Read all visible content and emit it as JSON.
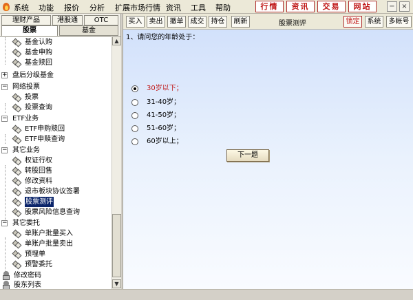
{
  "menubar": {
    "items": [
      "系统",
      "功能",
      "报价",
      "分析",
      "扩展市场行情",
      "资讯",
      "工具",
      "帮助"
    ],
    "right_buttons": [
      "行情",
      "资讯",
      "交易",
      "网站"
    ],
    "window_controls": {
      "minimize": "−",
      "close": "×"
    }
  },
  "sidebar": {
    "product_tabs": [
      "理财产品",
      "港股通",
      "OTC"
    ],
    "section_tabs": [
      "股票",
      "基金"
    ],
    "tree": [
      {
        "label": "基金认购"
      },
      {
        "label": "基金申购"
      },
      {
        "label": "基金赎回"
      },
      {
        "label": "盘后分级基金",
        "expander": "+"
      },
      {
        "label": "网络投票",
        "expander": "−"
      },
      {
        "label": "投票"
      },
      {
        "label": "投票查询"
      },
      {
        "label": "ETF业务",
        "expander": "−"
      },
      {
        "label": "ETF申购赎回"
      },
      {
        "label": "ETF申赎查询"
      },
      {
        "label": "其它业务",
        "expander": "−"
      },
      {
        "label": "权证行权"
      },
      {
        "label": "转股回售"
      },
      {
        "label": "修改资料"
      },
      {
        "label": "退市板块协议签署"
      },
      {
        "label": "股票测评"
      },
      {
        "label": "股票风险信息查询"
      },
      {
        "label": "其它委托",
        "expander": "−"
      },
      {
        "label": "单账户批量买入"
      },
      {
        "label": "单账户批量卖出"
      },
      {
        "label": "预埋单"
      },
      {
        "label": "预警委托"
      },
      {
        "label": "修改密码"
      },
      {
        "label": "股东列表"
      }
    ],
    "selected": "股票测评",
    "scroll_up": "▲",
    "scroll_down": "▼"
  },
  "toolbar": {
    "buttons": [
      "买入",
      "卖出",
      "撤单",
      "成交",
      "持仓",
      "刷新"
    ],
    "title": "股票测评",
    "right_buttons": [
      "锁定",
      "系统",
      "多帐号"
    ]
  },
  "survey": {
    "question": "1、请问您的年龄处于：",
    "options": [
      "30岁以下；",
      "31-40岁；",
      "41-50岁；",
      "51-60岁；",
      "60岁以上；"
    ],
    "selected_index": 0,
    "next_button": "下一题"
  },
  "colors": {
    "accent_red": "#c01818",
    "selection_blue": "#0a246a"
  }
}
